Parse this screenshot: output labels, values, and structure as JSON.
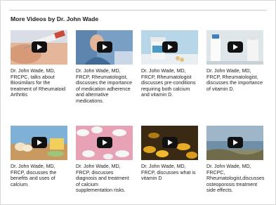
{
  "section": {
    "title": "More Videos by Dr. John Wade"
  },
  "videos": [
    {
      "caption": "Dr. John Wade, MD, FRCPC, talks about Biosimilars for the treatment of Rheumatoid Arthritis",
      "thumb_icon": "syringe-injection-thumbnail"
    },
    {
      "caption": "Dr. John Wade, MD, FRCP, Rheumatologist, discusses the importance of medication adherence and alternative medications.",
      "thumb_icon": "elderly-man-thumbnail"
    },
    {
      "caption": "Dr. John Wade, MD, FRCP, Rheumatologist discusses pre-conditions requiring both calcium and vitamin D.",
      "thumb_icon": "pill-bottle-thumbnail"
    },
    {
      "caption": "Dr. John Wade, MD, FRCP, Rheumatologist, discusses the importance of vitamin D.",
      "thumb_icon": "milk-bottles-thumbnail"
    },
    {
      "caption": "Dr. John Wade, MD, FRCP, discusses the benefits and uses of calcium.",
      "thumb_icon": "dairy-foods-thumbnail"
    },
    {
      "caption": "Dr. John Wade, MD, FRCP, discusses diagnosis and treatment of calcium supplementation risks.",
      "thumb_icon": "white-pills-thumbnail"
    },
    {
      "caption": "Dr. John Wade, MD, FRCP, discusses what is vitamin D",
      "thumb_icon": "vitamin-capsules-thumbnail"
    },
    {
      "caption": "Dr. John Wade, MD, FRCPC, Rheumatologist,discusses osteoporosis treatment side effects.",
      "thumb_icon": "sea-landscape-thumbnail"
    }
  ]
}
